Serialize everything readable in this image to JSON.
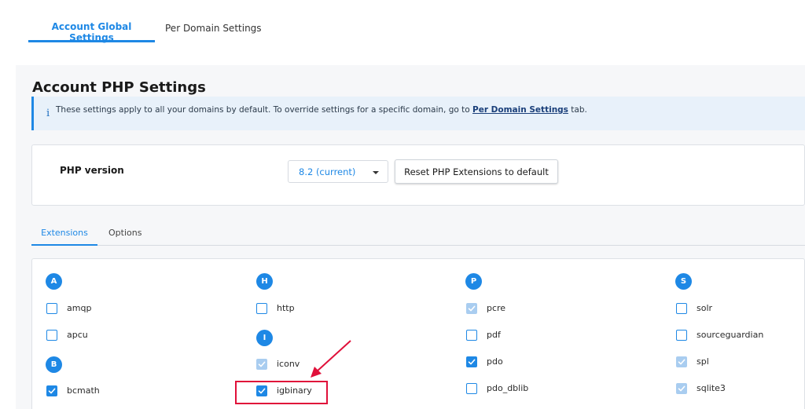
{
  "top_tabs": {
    "active": "Account Global Settings",
    "inactive": "Per Domain Settings"
  },
  "page": {
    "title": "Account PHP Settings",
    "info": {
      "icon": "i",
      "text_before": "These settings apply to all your domains by default. To override settings for a specific domain, go to ",
      "link": "Per Domain Settings",
      "text_after": " tab."
    }
  },
  "php_version": {
    "label": "PHP version",
    "selected": "8.2 (current)",
    "reset_label": "Reset PHP Extensions to default"
  },
  "sub_tabs": {
    "active": "Extensions",
    "inactive": "Options"
  },
  "extensions": {
    "col_a": {
      "letter_a": "A",
      "amqp": "amqp",
      "apcu": "apcu",
      "letter_b": "B",
      "bcmath": "bcmath"
    },
    "col_h": {
      "letter_h": "H",
      "http": "http",
      "letter_i": "I",
      "iconv": "iconv",
      "igbinary": "igbinary"
    },
    "col_p": {
      "letter_p": "P",
      "pcre": "pcre",
      "pdf": "pdf",
      "pdo": "pdo",
      "pdo_dblib": "pdo_dblib"
    },
    "col_s": {
      "letter_s": "S",
      "solr": "solr",
      "sourceguardian": "sourceguardian",
      "spl": "spl",
      "sqlite3": "sqlite3"
    },
    "states": {
      "amqp": "unchecked",
      "apcu": "unchecked",
      "bcmath": "checked",
      "http": "unchecked",
      "iconv": "checked-disabled",
      "igbinary": "checked",
      "pcre": "checked-disabled",
      "pdf": "unchecked",
      "pdo": "checked",
      "pdo_dblib": "unchecked",
      "solr": "unchecked",
      "sourceguardian": "unchecked",
      "spl": "checked-disabled",
      "sqlite3": "checked-disabled"
    }
  },
  "colors": {
    "accent": "#1e88e5",
    "annotation": "#e0103a"
  },
  "icons": {
    "info": "info-icon",
    "caret": "chevron-down-icon",
    "check": "check-icon",
    "annotation_arrow": "arrow-icon"
  }
}
